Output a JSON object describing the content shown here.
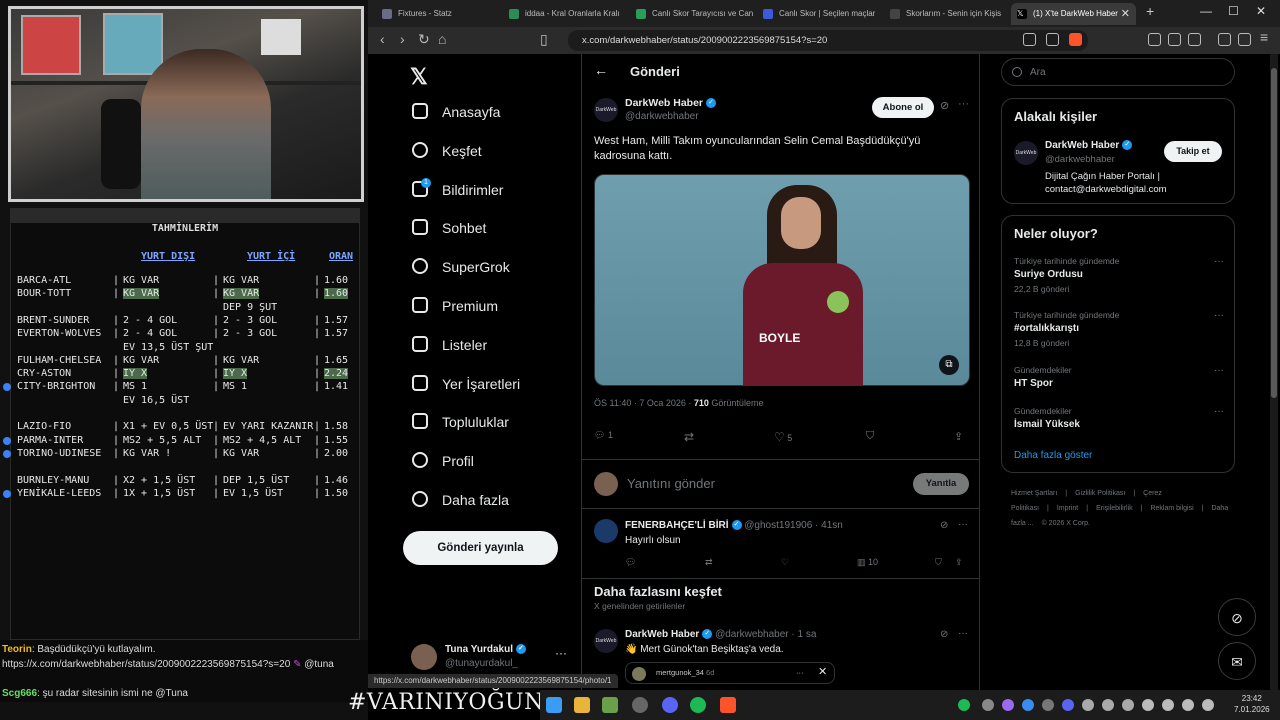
{
  "stream": {
    "predictions": {
      "title": "TAHMİNLERİM",
      "col_abroad": "YURT DIŞI",
      "col_domestic": "YURT İÇİ",
      "col_odds": "ORAN",
      "rows": [
        {
          "match": "BARCA-ATL",
          "abroad": "KG VAR",
          "domestic": "KG VAR",
          "odds": "1.60",
          "highlight": false,
          "dot": false
        },
        {
          "match": "BOUR-TOTT",
          "abroad": "KG VAR",
          "domestic": "KG VAR",
          "odds": "1.60",
          "highlight": true,
          "dot": false
        },
        {
          "match": "",
          "abroad": "",
          "domestic": "DEP 9 ŞUT",
          "odds": "",
          "highlight": false,
          "dot": false
        },
        {
          "match": "BRENT-SUNDER",
          "abroad": "2 - 4 GOL",
          "domestic": "2 - 3 GOL",
          "odds": "1.57",
          "highlight": false,
          "dot": false
        },
        {
          "match": "EVERTON-WOLVES",
          "abroad": "2 - 4 GOL",
          "domestic": "2 - 3 GOL",
          "odds": "1.57",
          "highlight": false,
          "dot": false
        },
        {
          "match": "",
          "abroad": "EV 13,5 ÜST ŞUT",
          "domestic": "",
          "odds": "",
          "highlight": false,
          "dot": false
        },
        {
          "match": "FULHAM-CHELSEA",
          "abroad": "KG VAR",
          "domestic": "KG VAR",
          "odds": "1.65",
          "highlight": false,
          "dot": false
        },
        {
          "match": "CRY-ASTON",
          "abroad": "IY X",
          "domestic": "IY X",
          "odds": "2.24",
          "highlight": true,
          "dot": false
        },
        {
          "match": "CITY-BRIGHTON",
          "abroad": "MS 1",
          "domestic": "MS 1",
          "odds": "1.41",
          "highlight": false,
          "dot": true
        },
        {
          "match": "",
          "abroad": "EV 16,5 ÜST",
          "domestic": "",
          "odds": "",
          "highlight": false,
          "dot": false
        },
        {
          "match": "",
          "abroad": "",
          "domestic": "",
          "odds": "",
          "highlight": false,
          "dot": false
        },
        {
          "match": "LAZIO-FIO",
          "abroad": "X1 + EV 0,5 ÜST",
          "domestic": "EV YARI KAZANIR",
          "odds": "1.58",
          "highlight": false,
          "dot": false
        },
        {
          "match": "PARMA-INTER",
          "abroad": "MS2 + 5,5 ALT",
          "domestic": "MS2 + 4,5 ALT",
          "odds": "1.55",
          "highlight": false,
          "dot": true
        },
        {
          "match": "TORINO-UDINESE",
          "abroad": "KG VAR !",
          "domestic": "KG VAR",
          "odds": "2.00",
          "highlight": false,
          "dot": true
        },
        {
          "match": "",
          "abroad": "",
          "domestic": "",
          "odds": "",
          "highlight": false,
          "dot": false
        },
        {
          "match": "BURNLEY-MANU",
          "abroad": "X2 + 1,5 ÜST",
          "domestic": "DEP 1,5 ÜST",
          "odds": "1.46",
          "highlight": false,
          "dot": false
        },
        {
          "match": "YENİKALE-LEEDS",
          "abroad": "1X + 1,5 ÜST",
          "domestic": "EV 1,5 ÜST",
          "odds": "1.50",
          "highlight": false,
          "dot": true
        }
      ]
    },
    "chat": {
      "line1_user": "Teorin",
      "line1_text": ": Başdüdükçü'yü kutlayalım.",
      "line2_text": "https://x.com/darkwebhaber/status/2009002223569875154?s=20",
      "line2_suffix": "@tuna",
      "line3_user": "Scg666",
      "line3_text": ": şu radar sitesinin ismi ne @Tuna"
    },
    "hashtag": "#VARINIYOĞUNU"
  },
  "browser": {
    "tabs": [
      {
        "label": "Fixtures - Statz",
        "color": "#6a6a8a"
      },
      {
        "label": "iddaa - Kral Oranlarla Kralı",
        "color": "#2e8b57"
      },
      {
        "label": "Canlı Skor Tarayıcısı ve Can",
        "color": "#2a9d5a"
      },
      {
        "label": "Canlı Skor | Seçilen maçlar",
        "color": "#3b5bdb"
      },
      {
        "label": "Skorlarım - Senin için Kişis",
        "color": "#444"
      },
      {
        "label": "(1) X'te DarkWeb Haber",
        "color": "#000"
      }
    ],
    "url": "x.com/darkwebhaber/status/2009002223569875154?s=20"
  },
  "x": {
    "nav": [
      {
        "label": "Anasayfa",
        "icon": "home-icon"
      },
      {
        "label": "Keşfet",
        "icon": "search-icon"
      },
      {
        "label": "Bildirimler",
        "icon": "bell-icon"
      },
      {
        "label": "Sohbet",
        "icon": "mail-icon"
      },
      {
        "label": "SuperGrok",
        "icon": "grok-icon"
      },
      {
        "label": "Premium",
        "icon": "x-premium-icon"
      },
      {
        "label": "Listeler",
        "icon": "list-icon"
      },
      {
        "label": "Yer İşaretleri",
        "icon": "bookmark-icon"
      },
      {
        "label": "Topluluklar",
        "icon": "communities-icon"
      },
      {
        "label": "Profil",
        "icon": "profile-icon"
      },
      {
        "label": "Daha fazla",
        "icon": "more-icon"
      }
    ],
    "notif_count": "1",
    "post_button": "Gönderi yayınla",
    "me": {
      "name": "Tuna Yurdakul",
      "handle": "@tunayurdakul_"
    },
    "page_title": "Gönderi",
    "post": {
      "author": "DarkWeb Haber",
      "handle": "@darkwebhaber",
      "avatar_text": "DarkWeb",
      "follow": "Abone ol",
      "text": "West Ham, Milli Takım oyuncularından Selin Cemal Başdüdükçü'yü kadrosuna kattı.",
      "sponsor": "BOYLE",
      "time": "ÖS 11:40 · 7 Oca 2026 · ",
      "views": "710",
      "views_label": " Görüntüleme",
      "replies": "1",
      "likes": "5"
    },
    "reply": {
      "placeholder": "Yanıtını gönder",
      "button": "Yanıtla"
    },
    "comment": {
      "author": "FENERBAHÇE'Lİ BİRİ",
      "handle": "@ghost191906 · 41sn",
      "text": "Hayırlı olsun",
      "views": "10"
    },
    "discover": {
      "title": "Daha fazlasını keşfet",
      "subtitle": "X genelinden getirilenler"
    },
    "rec": {
      "author": "DarkWeb Haber",
      "handle": "@darkwebhaber · 1 sa",
      "text": "👋 Mert Günok'tan Beşiktaş'a veda.",
      "quoted": "mertgunok_34",
      "quoted_time": "6d"
    },
    "hover_url": "https://x.com/darkwebhaber/status/2009002223569875154/photo/1",
    "search_placeholder": "Ara",
    "related": {
      "title": "Alakalı kişiler",
      "name": "DarkWeb Haber",
      "handle": "@darkwebhaber",
      "follow": "Takip et",
      "bio_line1": "Dijital Çağın Haber Portalı |",
      "bio_line2": "contact@darkwebdigital.com"
    },
    "trends": {
      "title": "Neler oluyor?",
      "items": [
        {
          "context": "Türkiye tarihinde gündemde",
          "name": "Suriye Ordusu",
          "count": "22,2 B gönderi"
        },
        {
          "context": "Türkiye tarihinde gündemde",
          "name": "#ortalıkkarıştı",
          "count": "12,8 B gönderi"
        },
        {
          "context": "Gündemdekiler",
          "name": "HT Spor",
          "count": ""
        },
        {
          "context": "Gündemdekiler",
          "name": "İsmail Yüksek",
          "count": ""
        }
      ],
      "show_more": "Daha fazla göster"
    },
    "footer": [
      "Hizmet Şartları",
      "|",
      "Gizlilik Politikası",
      "|",
      "Çerez Politikası",
      "|",
      "Imprint",
      "|",
      "Erişilebilirlik",
      "|",
      "Reklam bilgisi",
      "|",
      "Daha fazla ...",
      "© 2026 X Corp."
    ]
  },
  "taskbar": {
    "time": "23:42",
    "date": "7.01.2026"
  }
}
